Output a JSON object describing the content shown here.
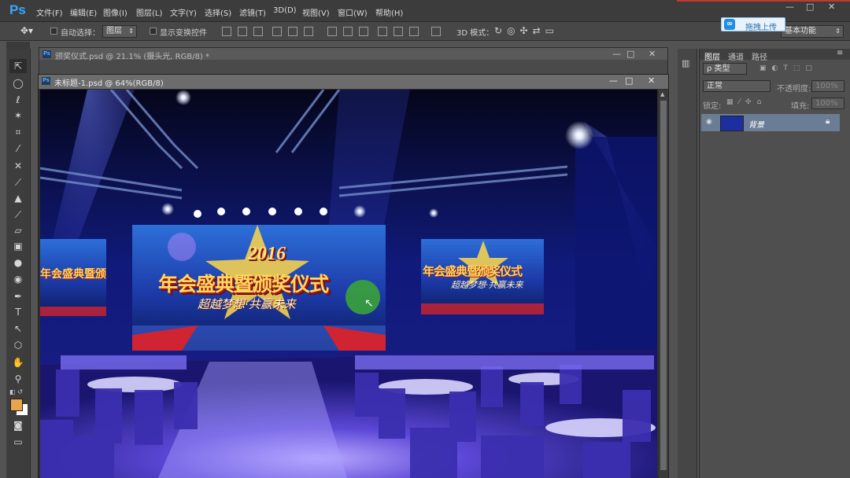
{
  "app": {
    "logo": "Ps"
  },
  "menu": [
    "文件(F)",
    "编辑(E)",
    "图像(I)",
    "图层(L)",
    "文字(Y)",
    "选择(S)",
    "滤镜(T)",
    "3D(D)",
    "视图(V)",
    "窗口(W)",
    "帮助(H)"
  ],
  "window_controls": {
    "minimize": "—",
    "maximize": "□",
    "close": "✕"
  },
  "options_bar": {
    "auto_select_label": "自动选择：",
    "auto_select_value": "图层",
    "show_transform_label": "显示变换控件",
    "mode_3d_label": "3D 模式：",
    "workspace_value": "基本功能",
    "upload_button": "拖拽上传"
  },
  "documents": [
    {
      "title": "颁奖仪式.psd @ 21.1% (摄头光, RGB/8) *"
    },
    {
      "title": "未标题-1.psd @ 64%(RGB/8)"
    }
  ],
  "stage": {
    "year": "2016",
    "title": "年会盛典暨颁奖仪式",
    "subtitle": "超越梦想·共赢未来",
    "side_title": "年会盛典暨颁奖仪式",
    "side_subtitle": "超越梦想·共赢未来"
  },
  "layers_panel": {
    "tabs": [
      "图层",
      "通道",
      "路径"
    ],
    "filter_label": "ρ 类型",
    "blend_mode": "正常",
    "opacity_label": "不透明度:",
    "opacity_value": "100%",
    "lock_label": "锁定:",
    "fill_label": "填充:",
    "fill_value": "100%",
    "layer_name": "背景"
  },
  "colors": {
    "foreground": "#e8a54a",
    "background": "#ffffff",
    "accent": "#39a6ff",
    "layer_selected": "#6b7d94"
  }
}
